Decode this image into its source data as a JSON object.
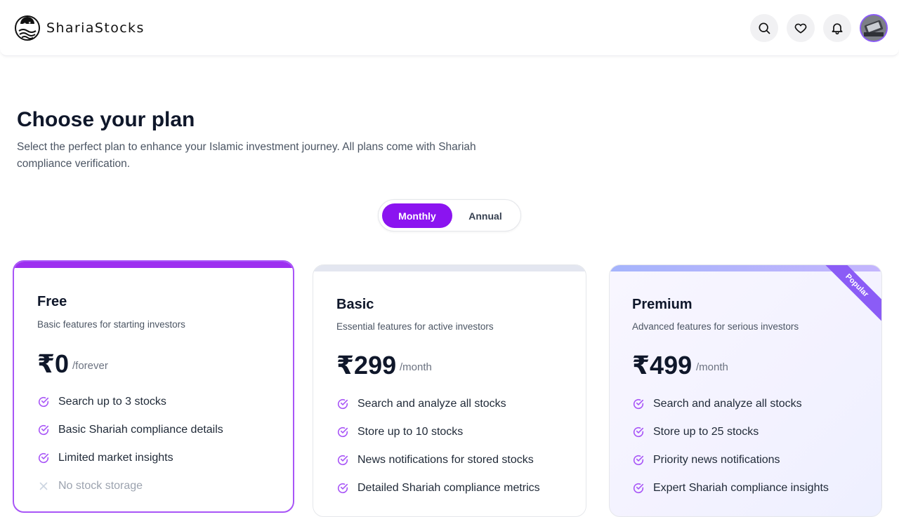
{
  "brand": {
    "name": "ShariaStocks"
  },
  "header_icons": [
    "search-icon",
    "heart-icon",
    "bell-icon"
  ],
  "page": {
    "title": "Choose your plan",
    "subtitle": "Select the perfect plan to enhance your Islamic investment journey. All plans come with Shariah compliance verification."
  },
  "billing_toggle": {
    "monthly": "Monthly",
    "annual": "Annual",
    "selected": "Monthly"
  },
  "colors": {
    "accent": "#8b14f0",
    "check": "#a855f7",
    "text": "#0f172a"
  },
  "plans": [
    {
      "name": "Free",
      "description": "Basic features for starting investors",
      "price": "₹0",
      "period": "/forever",
      "features": [
        {
          "text": "Search up to 3 stocks",
          "included": true
        },
        {
          "text": "Basic Shariah compliance details",
          "included": true
        },
        {
          "text": "Limited market insights",
          "included": true
        },
        {
          "text": "No stock storage",
          "included": false
        }
      ]
    },
    {
      "name": "Basic",
      "description": "Essential features for active investors",
      "price": "₹299",
      "period": "/month",
      "features": [
        {
          "text": "Search and analyze all stocks",
          "included": true
        },
        {
          "text": "Store up to 10 stocks",
          "included": true
        },
        {
          "text": "News notifications for stored stocks",
          "included": true
        },
        {
          "text": "Detailed Shariah compliance metrics",
          "included": true
        }
      ]
    },
    {
      "name": "Premium",
      "badge": "Popular",
      "description": "Advanced features for serious investors",
      "price": "₹499",
      "period": "/month",
      "features": [
        {
          "text": "Search and analyze all stocks",
          "included": true
        },
        {
          "text": "Store up to 25 stocks",
          "included": true
        },
        {
          "text": "Priority news notifications",
          "included": true
        },
        {
          "text": "Expert Shariah compliance insights",
          "included": true
        }
      ]
    }
  ]
}
